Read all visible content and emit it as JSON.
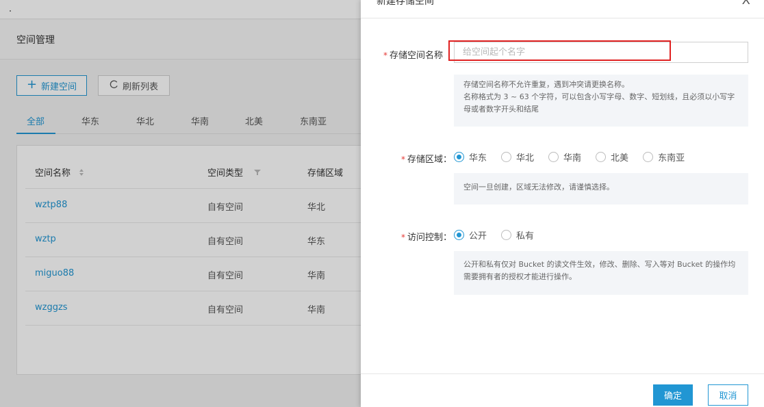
{
  "background": {
    "page_title": "空间管理",
    "new_button_label": "新建空间",
    "refresh_button_label": "刷新列表",
    "region_tabs": [
      "全部",
      "华东",
      "华北",
      "华南",
      "北美",
      "东南亚"
    ],
    "table": {
      "headers": [
        "空间名称",
        "空间类型",
        "存储区域"
      ],
      "rows": [
        {
          "name": "wztp88",
          "type": "自有空间",
          "region": "华北"
        },
        {
          "name": "wztp",
          "type": "自有空间",
          "region": "华东"
        },
        {
          "name": "miguo88",
          "type": "自有空间",
          "region": "华南"
        },
        {
          "name": "wzggzs",
          "type": "自有空间",
          "region": "华南"
        }
      ]
    }
  },
  "drawer": {
    "title": "新建存储空间",
    "close_label": "X",
    "name_field": {
      "label": "存储空间名称",
      "placeholder": "给空间起个名字",
      "value": "",
      "hint_lines": [
        "存储空间名称不允许重复，遇到冲突请更换名称。",
        "名称格式为 3 ~ 63 个字符，可以包含小写字母、数字、短划线，且必须以小写字母或者数字开头和结尾"
      ]
    },
    "region_field": {
      "label": "存储区域：",
      "options": [
        "华东",
        "华北",
        "华南",
        "北美",
        "东南亚"
      ],
      "selected": "华东",
      "hint": "空间一旦创建，区域无法修改，请谨慎选择。"
    },
    "access_field": {
      "label": "访问控制：",
      "options": [
        "公开",
        "私有"
      ],
      "selected": "公开",
      "hint": "公开和私有仅对 Bucket 的读文件生效，修改、删除、写入等对 Bucket 的操作均需要拥有者的授权才能进行操作。"
    },
    "confirm_label": "确定",
    "cancel_label": "取消"
  },
  "colors": {
    "accent": "#2196d3",
    "required": "#e53935",
    "highlight": "#e02020"
  }
}
